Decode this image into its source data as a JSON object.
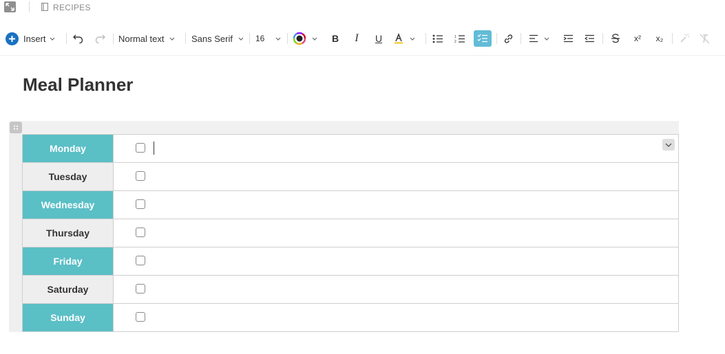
{
  "breadcrumb": {
    "label": "RECIPES"
  },
  "toolbar": {
    "insert_label": "Insert",
    "text_style": "Normal text",
    "font_family": "Sans Serif",
    "font_size": "16",
    "bold": "B",
    "italic": "I",
    "underline": "U",
    "superscript": "x²",
    "subscript": "x₂",
    "active_button": "checklist",
    "accent_color": "#1971c2",
    "active_color": "#63bcd7"
  },
  "document": {
    "title": "Meal Planner"
  },
  "table": {
    "rows": [
      {
        "day": "Monday",
        "checked": false,
        "text": ""
      },
      {
        "day": "Tuesday",
        "checked": false,
        "text": ""
      },
      {
        "day": "Wednesday",
        "checked": false,
        "text": ""
      },
      {
        "day": "Thursday",
        "checked": false,
        "text": ""
      },
      {
        "day": "Friday",
        "checked": false,
        "text": ""
      },
      {
        "day": "Saturday",
        "checked": false,
        "text": ""
      },
      {
        "day": "Sunday",
        "checked": false,
        "text": ""
      }
    ],
    "teal_color": "#5bbfc6",
    "gray_color": "#eeeeee"
  }
}
